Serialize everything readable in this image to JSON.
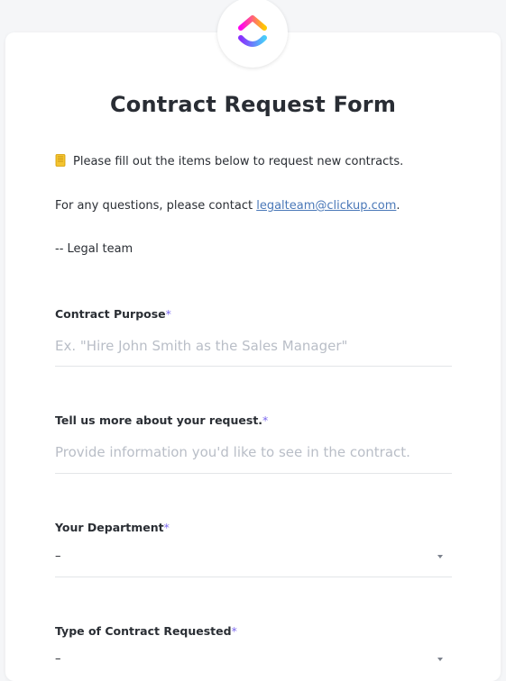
{
  "form": {
    "title": "Contract Request Form",
    "intro_text": "Please fill out the items below to request new contracts.",
    "questions_prefix": "For any questions, please contact ",
    "contact_email": "legalteam@clickup.com",
    "questions_suffix": ".",
    "signature": "-- Legal team",
    "required_marker": "*",
    "fields": [
      {
        "label": "Contract Purpose",
        "placeholder": "Ex. \"Hire John Smith as the Sales Manager\""
      },
      {
        "label": "Tell us more about your request.",
        "placeholder": "Provide information you'd like to see in the contract."
      },
      {
        "label": "Your Department",
        "value": "–"
      },
      {
        "label": "Type of Contract Requested",
        "value": "–"
      }
    ]
  },
  "icons": {
    "logo": "clickup-logo-icon",
    "notebook": "notebook-emoji-icon",
    "dropdown": "chevron-down-icon"
  },
  "colors": {
    "required": "#7b68ee",
    "link": "#4a78b8",
    "logo_gradient": [
      "#ff02f0",
      "#ffc800",
      "#8930fd",
      "#49ccf9"
    ]
  }
}
